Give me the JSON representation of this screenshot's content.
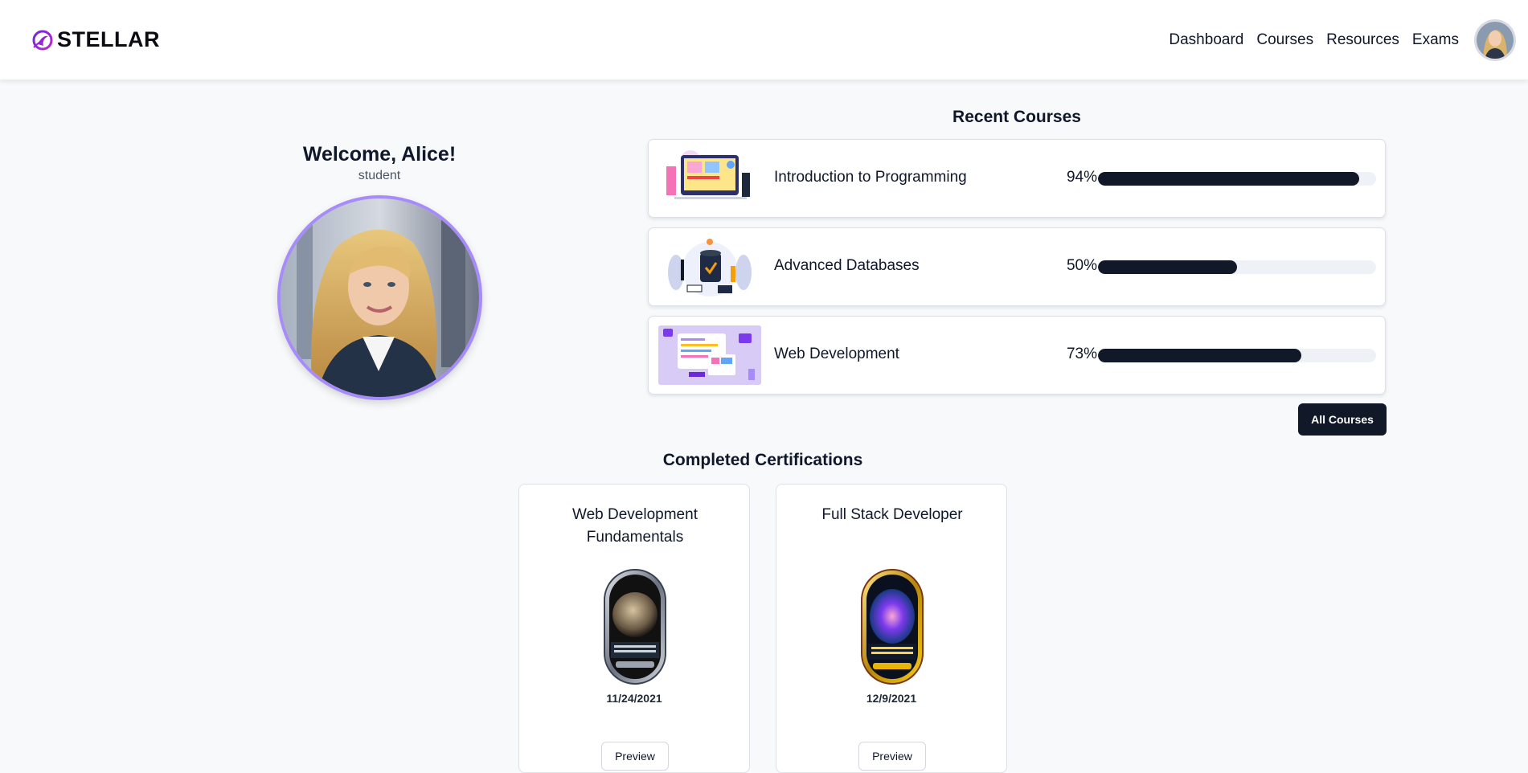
{
  "brand": {
    "name": "STELLAR",
    "logo_icon": "stellar-logo-icon",
    "accent": "#7c3aed"
  },
  "nav": {
    "items": [
      "Dashboard",
      "Courses",
      "Resources",
      "Exams"
    ],
    "avatar_icon": "user-avatar"
  },
  "welcome": {
    "greeting": "Welcome, Alice!",
    "role": "student"
  },
  "recent_courses": {
    "title": "Recent Courses",
    "items": [
      {
        "title": "Introduction to Programming",
        "progress_label": "94%",
        "progress": 0.94
      },
      {
        "title": "Advanced Databases",
        "progress_label": "50%",
        "progress": 0.5
      },
      {
        "title": "Web Development",
        "progress_label": "73%",
        "progress": 0.73
      }
    ],
    "all_button": "All Courses"
  },
  "certifications": {
    "title": "Completed Certifications",
    "items": [
      {
        "name": "Web Development Fundamentals",
        "date": "11/24/2021",
        "preview": "Preview",
        "badge_color": "#9ca3af"
      },
      {
        "name": "Full Stack Developer",
        "date": "12/9/2021",
        "preview": "Preview",
        "badge_color": "#d4a017"
      }
    ]
  }
}
